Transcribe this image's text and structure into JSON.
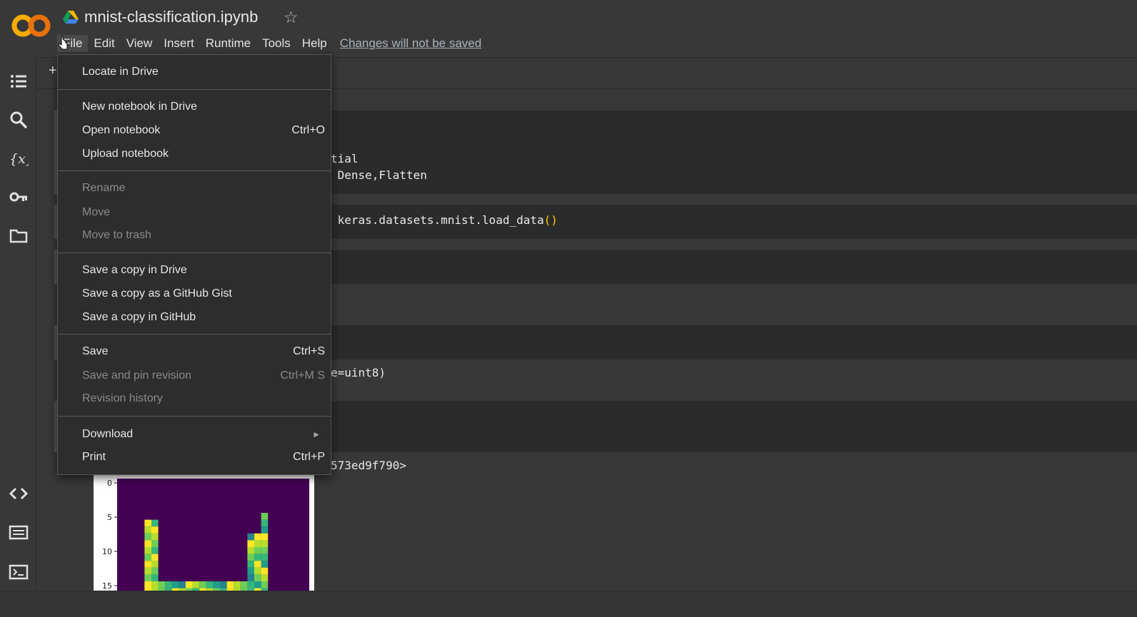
{
  "header": {
    "title": "mnist-classification.ipynb",
    "menu": [
      "File",
      "Edit",
      "View",
      "Insert",
      "Runtime",
      "Tools",
      "Help"
    ],
    "changes_notice": "Changes will not be saved"
  },
  "toolbar": {
    "add_label": "+"
  },
  "file_menu": {
    "items": [
      {
        "label": "Locate in Drive",
        "shortcut": "",
        "disabled": false
      },
      {
        "label": "New notebook in Drive",
        "shortcut": "",
        "disabled": false
      },
      {
        "label": "Open notebook",
        "shortcut": "Ctrl+O",
        "disabled": false
      },
      {
        "label": "Upload notebook",
        "shortcut": "",
        "disabled": false
      },
      {
        "label": "Rename",
        "shortcut": "",
        "disabled": true
      },
      {
        "label": "Move",
        "shortcut": "",
        "disabled": true
      },
      {
        "label": "Move to trash",
        "shortcut": "",
        "disabled": true
      },
      {
        "label": "Save a copy in Drive",
        "shortcut": "",
        "disabled": false
      },
      {
        "label": "Save a copy as a GitHub Gist",
        "shortcut": "",
        "disabled": false
      },
      {
        "label": "Save a copy in GitHub",
        "shortcut": "",
        "disabled": false
      },
      {
        "label": "Save",
        "shortcut": "Ctrl+S",
        "disabled": false
      },
      {
        "label": "Save and pin revision",
        "shortcut": "Ctrl+M S",
        "disabled": true
      },
      {
        "label": "Revision history",
        "shortcut": "",
        "disabled": true
      },
      {
        "label": "Download",
        "shortcut": "",
        "disabled": false
      },
      {
        "label": "Print",
        "shortcut": "Ctrl+P",
        "disabled": false
      }
    ]
  },
  "cells": {
    "c1_line1": "tial",
    "c1_line2": " Dense,Flatten",
    "c2_line1": " keras.datasets.mnist.load_data",
    "c2_paren": "()",
    "c3_line1": "e=uint8)",
    "c4_line1": "573ed9f790>"
  },
  "plot": {
    "y_ticks": [
      "0",
      "5",
      "10",
      "15"
    ]
  },
  "colors": {
    "background": "#383838",
    "menu_bg": "#2d2d2d",
    "link": "#aab0b8",
    "paren": "#f5d000",
    "viridis_dark": "#440154",
    "viridis_yellow": "#fde725"
  }
}
